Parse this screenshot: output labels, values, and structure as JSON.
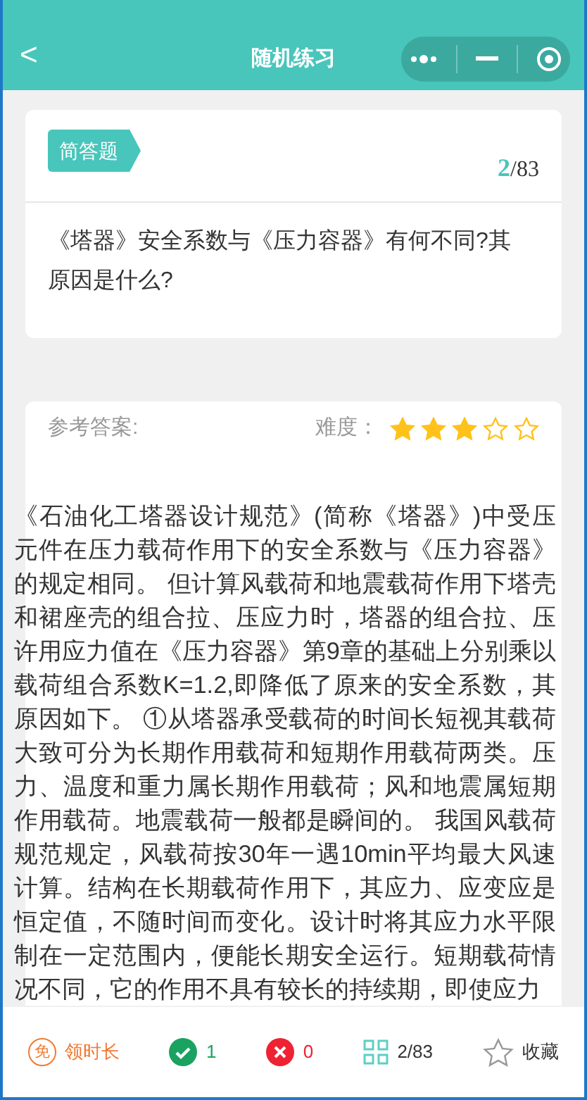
{
  "header": {
    "back": "<",
    "title": "随机练习"
  },
  "question": {
    "type_tag": "简答题",
    "current": "2",
    "total": "/83",
    "text": "《塔器》安全系数与《压力容器》有何不同?其原因是什么?"
  },
  "answer": {
    "label": "参考答案:",
    "difficulty_label": "难度：",
    "stars": 3,
    "text": "《石油化工塔器设计规范》(简称《塔器》)中受压元件在压力载荷作用下的安全系数与《压力容器》的规定相同。 但计算风载荷和地震载荷作用下塔壳和裙座壳的组合拉、压应力时，塔器的组合拉、压许用应力值在《压力容器》第9章的基础上分别乘以载荷组合系数K=1.2,即降低了原来的安全系数，其原因如下。 ①从塔器承受载荷的时间长短视其载荷大致可分为长期作用载荷和短期作用载荷两类。压力、温度和重力属长期作用载荷；风和地震属短期作用载荷。地震载荷一般都是瞬间的。 我国风载荷规范规定，风载荷按30年一遇10min平均最大风速计算。结构在长期载荷作用下，其应力、应变应是恒定值，不随时间而变化。设计时将其应力水平限制在一定范围内，便能长期安全运行。短期载荷情况不同，它的作用不具有较长的持续期，即使应力"
  },
  "footer": [
    {
      "kind": "timer",
      "icon_char": "免",
      "label": "领时长"
    },
    {
      "kind": "correct",
      "label": "1"
    },
    {
      "kind": "wrong",
      "label": "0"
    },
    {
      "kind": "card",
      "label": "2/83"
    },
    {
      "kind": "favorite",
      "label": "收藏"
    }
  ]
}
